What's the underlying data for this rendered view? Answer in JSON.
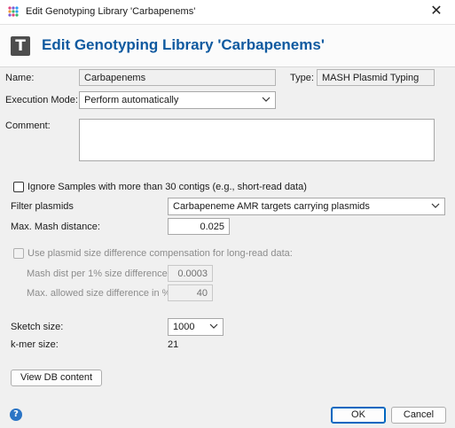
{
  "window": {
    "title": "Edit Genotyping Library 'Carbapenems'",
    "close_glyph": "✕"
  },
  "header": {
    "icon_letter": "T",
    "title": "Edit Genotyping Library 'Carbapenems'"
  },
  "form": {
    "name_label": "Name:",
    "name_value": "Carbapenems",
    "type_label": "Type:",
    "type_value": "MASH Plasmid Typing",
    "execution_mode_label": "Execution Mode:",
    "execution_mode_value": "Perform automatically",
    "comment_label": "Comment:",
    "comment_value": "",
    "ignore_samples_label": "Ignore Samples with more than 30 contigs (e.g., short-read data)",
    "ignore_samples_checked": false,
    "filter_plasmids_label": "Filter plasmids",
    "filter_plasmids_value": "Carbapeneme AMR targets carrying plasmids",
    "max_mash_label": "Max. Mash distance:",
    "max_mash_value": "0.025",
    "compensation_label": "Use plasmid size difference compensation for long-read data:",
    "compensation_checked": false,
    "mash_dist_label": "Mash dist per 1% size difference:",
    "mash_dist_value": "0.0003",
    "max_size_diff_label": "Max. allowed size difference in %:",
    "max_size_diff_value": "40",
    "sketch_size_label": "Sketch size:",
    "sketch_size_value": "1000",
    "kmer_size_label": "k-mer size:",
    "kmer_size_value": "21"
  },
  "buttons": {
    "view_db": "View DB content",
    "ok": "OK",
    "cancel": "Cancel",
    "help_glyph": "?"
  },
  "colors": {
    "header_title": "#0f5aa0",
    "primary_border": "#0067c0",
    "help_icon": "#2a74c5"
  }
}
